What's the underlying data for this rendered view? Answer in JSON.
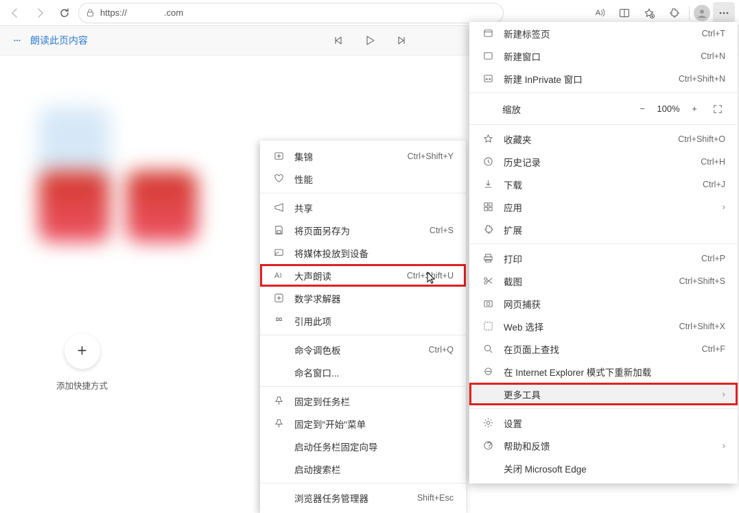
{
  "toolbar": {
    "url_prefix": "https://",
    "url_suffix": ".com"
  },
  "reader": {
    "label": "朗读此页内容"
  },
  "add_tile": {
    "label": "添加快捷方式"
  },
  "mainmenu": {
    "new_tab": {
      "label": "新建标签页",
      "sc": "Ctrl+T"
    },
    "new_win": {
      "label": "新建窗口",
      "sc": "Ctrl+N"
    },
    "new_priv": {
      "label": "新建 InPrivate 窗口",
      "sc": "Ctrl+Shift+N"
    },
    "zoom": {
      "label": "缩放",
      "value": "100%"
    },
    "fav": {
      "label": "收藏夹",
      "sc": "Ctrl+Shift+O"
    },
    "history": {
      "label": "历史记录",
      "sc": "Ctrl+H"
    },
    "download": {
      "label": "下载",
      "sc": "Ctrl+J"
    },
    "apps": {
      "label": "应用"
    },
    "ext": {
      "label": "扩展"
    },
    "print": {
      "label": "打印",
      "sc": "Ctrl+P"
    },
    "snip": {
      "label": "截图",
      "sc": "Ctrl+Shift+S"
    },
    "capture": {
      "label": "网页捕获"
    },
    "select": {
      "label": "Web 选择",
      "sc": "Ctrl+Shift+X"
    },
    "find": {
      "label": "在页面上查找",
      "sc": "Ctrl+F"
    },
    "ie": {
      "label": "在 Internet Explorer 模式下重新加载"
    },
    "moretools": {
      "label": "更多工具"
    },
    "settings": {
      "label": "设置"
    },
    "help": {
      "label": "帮助和反馈"
    },
    "close": {
      "label": "关闭 Microsoft Edge"
    }
  },
  "submenu": {
    "collections": {
      "label": "集锦",
      "sc": "Ctrl+Shift+Y"
    },
    "perf": {
      "label": "性能"
    },
    "share": {
      "label": "共享"
    },
    "saveas": {
      "label": "将页面另存为",
      "sc": "Ctrl+S"
    },
    "cast": {
      "label": "将媒体投放到设备"
    },
    "readaloud": {
      "label": "大声朗读",
      "sc": "Ctrl+Shift+U"
    },
    "math": {
      "label": "数学求解器"
    },
    "cite": {
      "label": "引用此项"
    },
    "palette": {
      "label": "命令调色板",
      "sc": "Ctrl+Q"
    },
    "namewin": {
      "label": "命名窗口..."
    },
    "pintb": {
      "label": "固定到任务栏"
    },
    "pinstart": {
      "label": "固定到\"开始\"菜单"
    },
    "tbwizard": {
      "label": "启动任务栏固定向导"
    },
    "searchbar": {
      "label": "启动搜索栏"
    },
    "taskmgr": {
      "label": "浏览器任务管理器",
      "sc": "Shift+Esc"
    }
  }
}
